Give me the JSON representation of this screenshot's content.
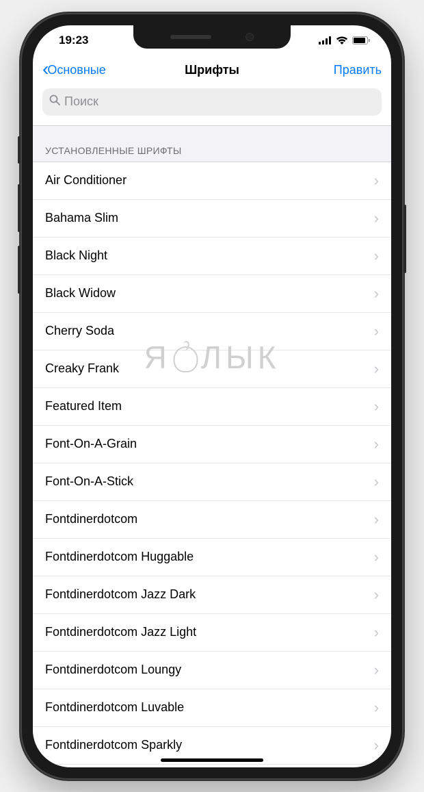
{
  "statusbar": {
    "time": "19:23"
  },
  "navbar": {
    "back_label": "Основные",
    "title": "Шрифты",
    "edit_label": "Править"
  },
  "search": {
    "placeholder": "Поиск"
  },
  "section": {
    "header": "УСТАНОВЛЕННЫЕ ШРИФТЫ"
  },
  "fonts": [
    "Air Conditioner",
    "Bahama Slim",
    "Black Night",
    "Black Widow",
    "Cherry Soda",
    "Creaky Frank",
    "Featured Item",
    "Font-On-A-Grain",
    "Font-On-A-Stick",
    "Fontdinerdotcom",
    "Fontdinerdotcom Huggable",
    "Fontdinerdotcom Jazz Dark",
    "Fontdinerdotcom Jazz Light",
    "Fontdinerdotcom Loungy",
    "Fontdinerdotcom Luvable",
    "Fontdinerdotcom Sparkly"
  ],
  "watermark": "ЯБЛЫК"
}
